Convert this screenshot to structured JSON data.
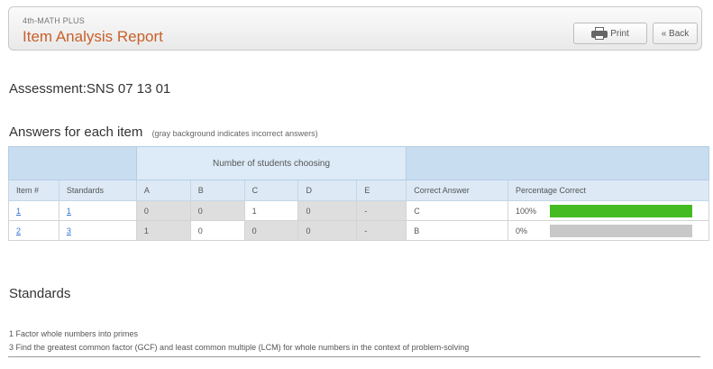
{
  "header": {
    "subtitle": "4th-MATH PLUS",
    "title": "Item Analysis Report",
    "print_label": "Print",
    "back_label": "« Back"
  },
  "assessment_label": "Assessment:SNS 07 13 01",
  "answers": {
    "title": "Answers for each item",
    "note": "(gray background indicates incorrect answers)"
  },
  "table": {
    "group_header": "Number of students choosing",
    "headers": [
      "Item #",
      "Standards",
      "A",
      "B",
      "C",
      "D",
      "E",
      "Correct Answer",
      "Percentage Correct"
    ],
    "rows": [
      {
        "item": "1",
        "standard": "1",
        "A": "0",
        "B": "0",
        "C": "1",
        "D": "0",
        "E": "-",
        "correct": "C",
        "percent_label": "100%",
        "percent": 100,
        "bar_color": "#44bb22"
      },
      {
        "item": "2",
        "standard": "3",
        "A": "1",
        "B": "0",
        "C": "0",
        "D": "0",
        "E": "-",
        "correct": "B",
        "percent_label": "0%",
        "percent": 0,
        "bar_color": "#c8c8c8"
      }
    ]
  },
  "standards": {
    "title": "Standards",
    "items": [
      "1  Factor whole numbers into primes",
      "3  Find the greatest common factor (GCF) and least common multiple (LCM) for whole numbers in the context of problem-solving"
    ]
  }
}
